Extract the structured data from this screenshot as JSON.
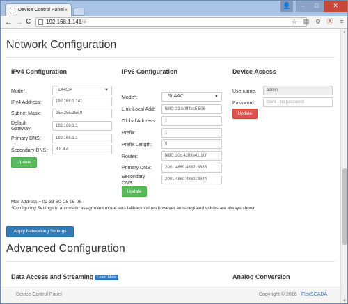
{
  "browser": {
    "tab_title": "Device Control Panel",
    "tab_close": "×",
    "url_host": "192.168.1.141",
    "url_hash": "/#",
    "window_buttons": {
      "user": "👤",
      "min": "–",
      "max": "□",
      "close": "✕"
    },
    "nav": {
      "back": "←",
      "forward": "→",
      "reload": "C"
    },
    "toolbar_icons": [
      "☆",
      "▤",
      "⚙",
      "Ⓐ",
      "≡"
    ]
  },
  "page": {
    "network_title": "Network Configuration",
    "advanced_title": "Advanced Configuration",
    "ipv4": {
      "heading": "IPv4 Configuration",
      "mode_label": "Mode*:",
      "mode_value": "DHCP",
      "address_label": "IPv4 Address:",
      "address_value": "192.168.1.141",
      "subnet_label": "Subnet Mask:",
      "subnet_value": "255.255.255.0",
      "gateway_label_1": "Default",
      "gateway_label_2": "Gateway:",
      "gateway_value": "192.168.1.1",
      "dns1_label": "Primary DNS:",
      "dns1_value": "192.168.1.1",
      "dns2_label": "Secondary DNS:",
      "dns2_value": "8.8.4.4",
      "update": "Update"
    },
    "ipv6": {
      "heading": "IPv6 Configuration",
      "mode_label": "Mode*:",
      "mode_value": "SLAAC",
      "linklocal_label": "Link-Local Add:",
      "linklocal_value": "fe80::33:b0ff:fec5:506",
      "global_label": "Global Address:",
      "global_value": "::",
      "prefix_label": "Prefix:",
      "prefix_value": "::",
      "prefixlen_label": "Prefix Length:",
      "prefixlen_value": "0",
      "router_label": "Router:",
      "router_value": "fe80::20c:42ff:fe41:10f",
      "dns1_label": "Primary DNS:",
      "dns1_value": "2001:4860:4860::8888",
      "dns2_label_1": "Secondary",
      "dns2_label_2": "DNS:",
      "dns2_value": "2001:4860:4860::8844",
      "update": "Update"
    },
    "access": {
      "heading": "Device Access",
      "username_label": "Username:",
      "username_value": "admin",
      "password_label": "Password:",
      "password_placeholder": "blank - no password",
      "update": "Update"
    },
    "mac_address": "Mac Address = 02-33-B0-C5-05-06",
    "note": "*Configuring Settings in automatic assignment mode sets fallback values however auto-negiated values are always shown",
    "apply_button": "Apply Networking Settings",
    "data_access_heading": "Data Access and Streaming",
    "learn_more": "Learn More",
    "analog_heading": "Analog Conversion",
    "footer_left": "Device Control Panel",
    "footer_right_prefix": "Copyright © 2016 - ",
    "footer_link": "FlexSCADA"
  }
}
